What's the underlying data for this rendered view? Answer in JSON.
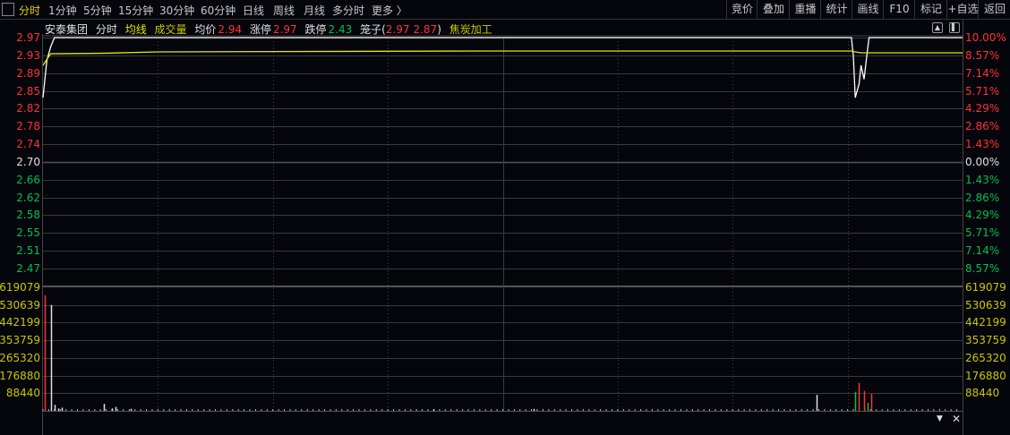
{
  "toolbar": {
    "tabs": [
      "分时",
      "1分钟",
      "5分钟",
      "15分钟",
      "30分钟",
      "60分钟",
      "日线",
      "周线",
      "月线",
      "多分时",
      "更多 〉"
    ],
    "right_buttons": [
      "竞价",
      "叠加",
      "重播",
      "统计",
      "画线",
      "F10",
      "标记",
      "+自选",
      "返回"
    ]
  },
  "info": {
    "name": "安泰集团",
    "mode": "分时",
    "avg_label": "均线",
    "vol_label": "成交量",
    "avg_price_label": "均价",
    "avg_price": "2.94",
    "limit_up_label": "涨停",
    "limit_up": "2.97",
    "limit_down_label": "跌停",
    "limit_down": "2.43",
    "basket_label": "笼子(",
    "basket_high": "2.97",
    "basket_low": "2.87",
    "basket_close": ")",
    "sector": "焦炭加工"
  },
  "chart_data": {
    "type": "line",
    "title": "安泰集团 分时",
    "price_axis": {
      "left_labels": [
        "2.97",
        "2.93",
        "2.89",
        "2.85",
        "2.82",
        "2.78",
        "2.74",
        "2.70",
        "2.66",
        "2.62",
        "2.58",
        "2.55",
        "2.51",
        "2.47"
      ],
      "right_labels": [
        "10.00%",
        "8.57%",
        "7.14%",
        "5.71%",
        "4.29%",
        "2.86%",
        "1.43%",
        "0.00%",
        "1.43%",
        "2.86%",
        "4.29%",
        "5.71%",
        "7.14%",
        "8.57%"
      ],
      "ylim": [
        2.47,
        2.97
      ],
      "prev_close": 2.7
    },
    "volume_axis": {
      "labels": [
        "619079",
        "530639",
        "442199",
        "353759",
        "265320",
        "176880",
        "88440"
      ],
      "ylim": [
        0,
        619079
      ]
    },
    "xlim": [
      0,
      240
    ],
    "series": [
      {
        "name": "价格",
        "color": "#ffffff",
        "points": [
          [
            0,
            2.84
          ],
          [
            1,
            2.92
          ],
          [
            2,
            2.95
          ],
          [
            3,
            2.97
          ],
          [
            211,
            2.97
          ],
          [
            211.5,
            2.93
          ],
          [
            212,
            2.84
          ],
          [
            213,
            2.87
          ],
          [
            213.5,
            2.91
          ],
          [
            214.3,
            2.88
          ],
          [
            215,
            2.93
          ],
          [
            215.6,
            2.97
          ],
          [
            240,
            2.97
          ]
        ]
      },
      {
        "name": "均线",
        "color": "#e6e600",
        "points": [
          [
            0,
            2.91
          ],
          [
            2,
            2.935
          ],
          [
            15,
            2.936
          ],
          [
            30,
            2.939
          ],
          [
            115,
            2.941
          ],
          [
            211,
            2.941
          ],
          [
            212,
            2.939
          ],
          [
            213.5,
            2.937
          ],
          [
            240,
            2.937
          ]
        ]
      }
    ],
    "volume": [
      [
        0.5,
        580000,
        "up"
      ],
      [
        2,
        530639,
        "flat"
      ],
      [
        3,
        30000,
        "flat"
      ],
      [
        4,
        12000,
        "flat"
      ],
      [
        5,
        16000,
        "flat"
      ],
      [
        16,
        35000,
        "flat"
      ],
      [
        18,
        12000,
        "flat"
      ],
      [
        19,
        20000,
        "flat"
      ],
      [
        23,
        10000,
        "flat"
      ],
      [
        102,
        8000,
        "flat"
      ],
      [
        128,
        10000,
        "flat"
      ],
      [
        202,
        80000,
        "flat"
      ],
      [
        212,
        95000,
        "down"
      ],
      [
        213,
        140000,
        "up"
      ],
      [
        214.2,
        100000,
        "up"
      ],
      [
        215.2,
        40000,
        "down"
      ],
      [
        216.2,
        85000,
        "up"
      ]
    ]
  },
  "colors": {
    "up": "#ff3232",
    "down": "#00c050",
    "flat": "#e0e0e0",
    "price_up": "#ff3232",
    "price_down": "#00c050",
    "volume_label": "#c8c800",
    "grid": "#3a3a3a"
  }
}
